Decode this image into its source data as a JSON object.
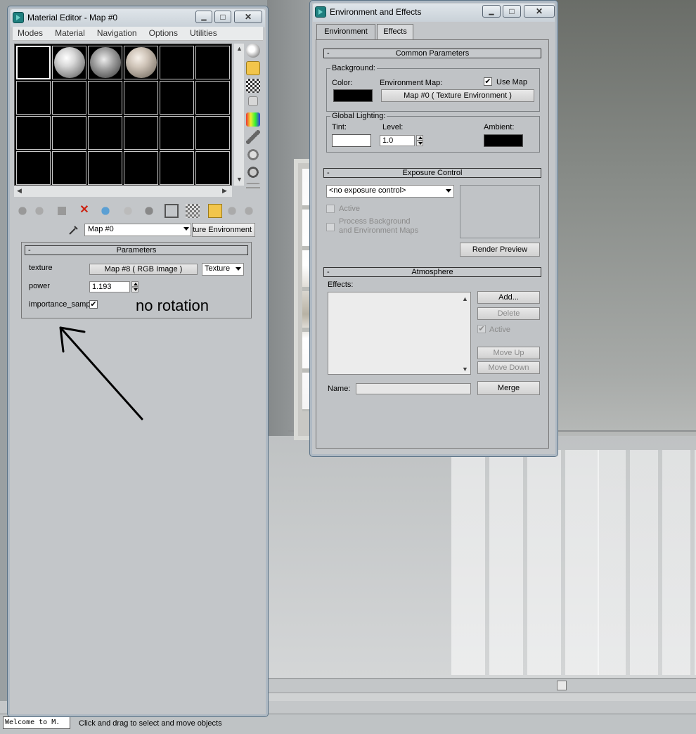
{
  "material_editor": {
    "title": "Material Editor - Map #0",
    "menu": [
      "Modes",
      "Material",
      "Navigation",
      "Options",
      "Utilities"
    ],
    "map_name": "Map #0",
    "map_type_button": "ture Environment",
    "parameters": {
      "header": "Parameters",
      "collapse": "-",
      "texture_label": "texture",
      "texture_button": "Map #8  ( RGB Image )",
      "texture_select": "Texture",
      "power_label": "power",
      "power_value": "1.193",
      "importance_label": "importance_sampl",
      "importance_checked": "✔"
    },
    "annotation": "no rotation"
  },
  "env_effects": {
    "title": "Environment and Effects",
    "tabs": [
      "Environment",
      "Effects"
    ],
    "common": {
      "header": "Common Parameters",
      "background_label": "Background:",
      "color_label": "Color:",
      "env_map_label": "Environment Map:",
      "use_map_label": "Use Map",
      "use_map_checked": "✔",
      "env_map_button": "Map #0  ( Texture Environment )",
      "global_lighting_label": "Global Lighting:",
      "tint_label": "Tint:",
      "level_label": "Level:",
      "level_value": "1.0",
      "ambient_label": "Ambient:"
    },
    "exposure": {
      "header": "Exposure Control",
      "select_value": "<no exposure control>",
      "active_label": "Active",
      "process_bg_label_1": "Process Background",
      "process_bg_label_2": "and Environment Maps",
      "render_preview_button": "Render Preview"
    },
    "atmosphere": {
      "header": "Atmosphere",
      "effects_label": "Effects:",
      "add_button": "Add...",
      "delete_button": "Delete",
      "active_label": "Active",
      "active_checked": "✔",
      "move_up_button": "Move Up",
      "move_down_button": "Move Down",
      "name_label": "Name:",
      "merge_button": "Merge"
    }
  },
  "window_buttons": {
    "minimize": "▁",
    "maximize": "□",
    "close": "✕"
  },
  "statusbar": {
    "welcome": "Welcome to M.",
    "status_text": "Click and drag to select and move objects"
  },
  "colors": {
    "swatch_color": "#000000",
    "tint_color": "#ffffff",
    "ambient_color": "#000000"
  }
}
